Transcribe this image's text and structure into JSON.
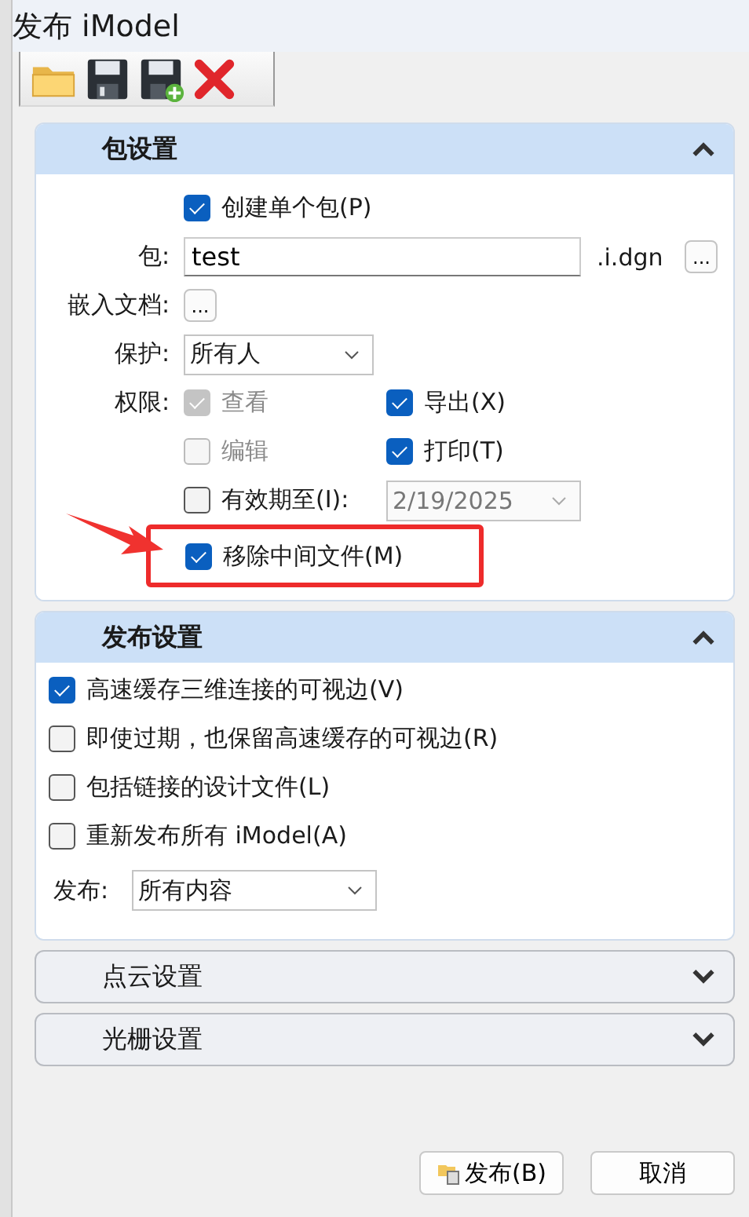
{
  "window": {
    "title": "发布 iModel"
  },
  "toolbar": [
    {
      "kind": "open"
    },
    {
      "kind": "save"
    },
    {
      "kind": "save-as"
    },
    {
      "kind": "delete"
    }
  ],
  "package_settings": {
    "title": "包设置",
    "expanded": true,
    "create_single": {
      "label": "创建单个包(P)",
      "checked": true
    },
    "package": {
      "label": "包:",
      "value": "test",
      "suffix": ".i.dgn",
      "browse": "..."
    },
    "embed": {
      "label": "嵌入文档:",
      "browse": "..."
    },
    "protect": {
      "label": "保护:",
      "value": "所有人"
    },
    "permissions": {
      "label": "权限:",
      "items": [
        {
          "label": "查看",
          "checked": true,
          "disabled": true
        },
        {
          "label": "导出(X)",
          "checked": true,
          "disabled": false
        },
        {
          "label": "编辑",
          "checked": false,
          "disabled": true
        },
        {
          "label": "打印(T)",
          "checked": true,
          "disabled": false
        }
      ]
    },
    "expires": {
      "label": "有效期至(I):",
      "checked": false,
      "date": "2/19/2025",
      "disabled": true
    },
    "remove_intermediate": {
      "label": "移除中间文件(M)",
      "checked": true,
      "highlighted": true
    }
  },
  "publish_settings": {
    "title": "发布设置",
    "expanded": true,
    "options": [
      {
        "label": "高速缓存三维连接的可视边(V)",
        "checked": true
      },
      {
        "label": "即使过期，也保留高速缓存的可视边(R)",
        "checked": false
      },
      {
        "label": "包括链接的设计文件(L)",
        "checked": false
      },
      {
        "label": "重新发布所有 iModel(A)",
        "checked": false
      }
    ],
    "publish": {
      "label": "发布:",
      "value": "所有内容"
    }
  },
  "collapsed_sections": [
    {
      "title": "点云设置",
      "expanded": false
    },
    {
      "title": "光栅设置",
      "expanded": false
    }
  ],
  "buttons": [
    {
      "label": "发布(B)",
      "kind": "publish"
    },
    {
      "label": "取消",
      "kind": "plain"
    }
  ]
}
